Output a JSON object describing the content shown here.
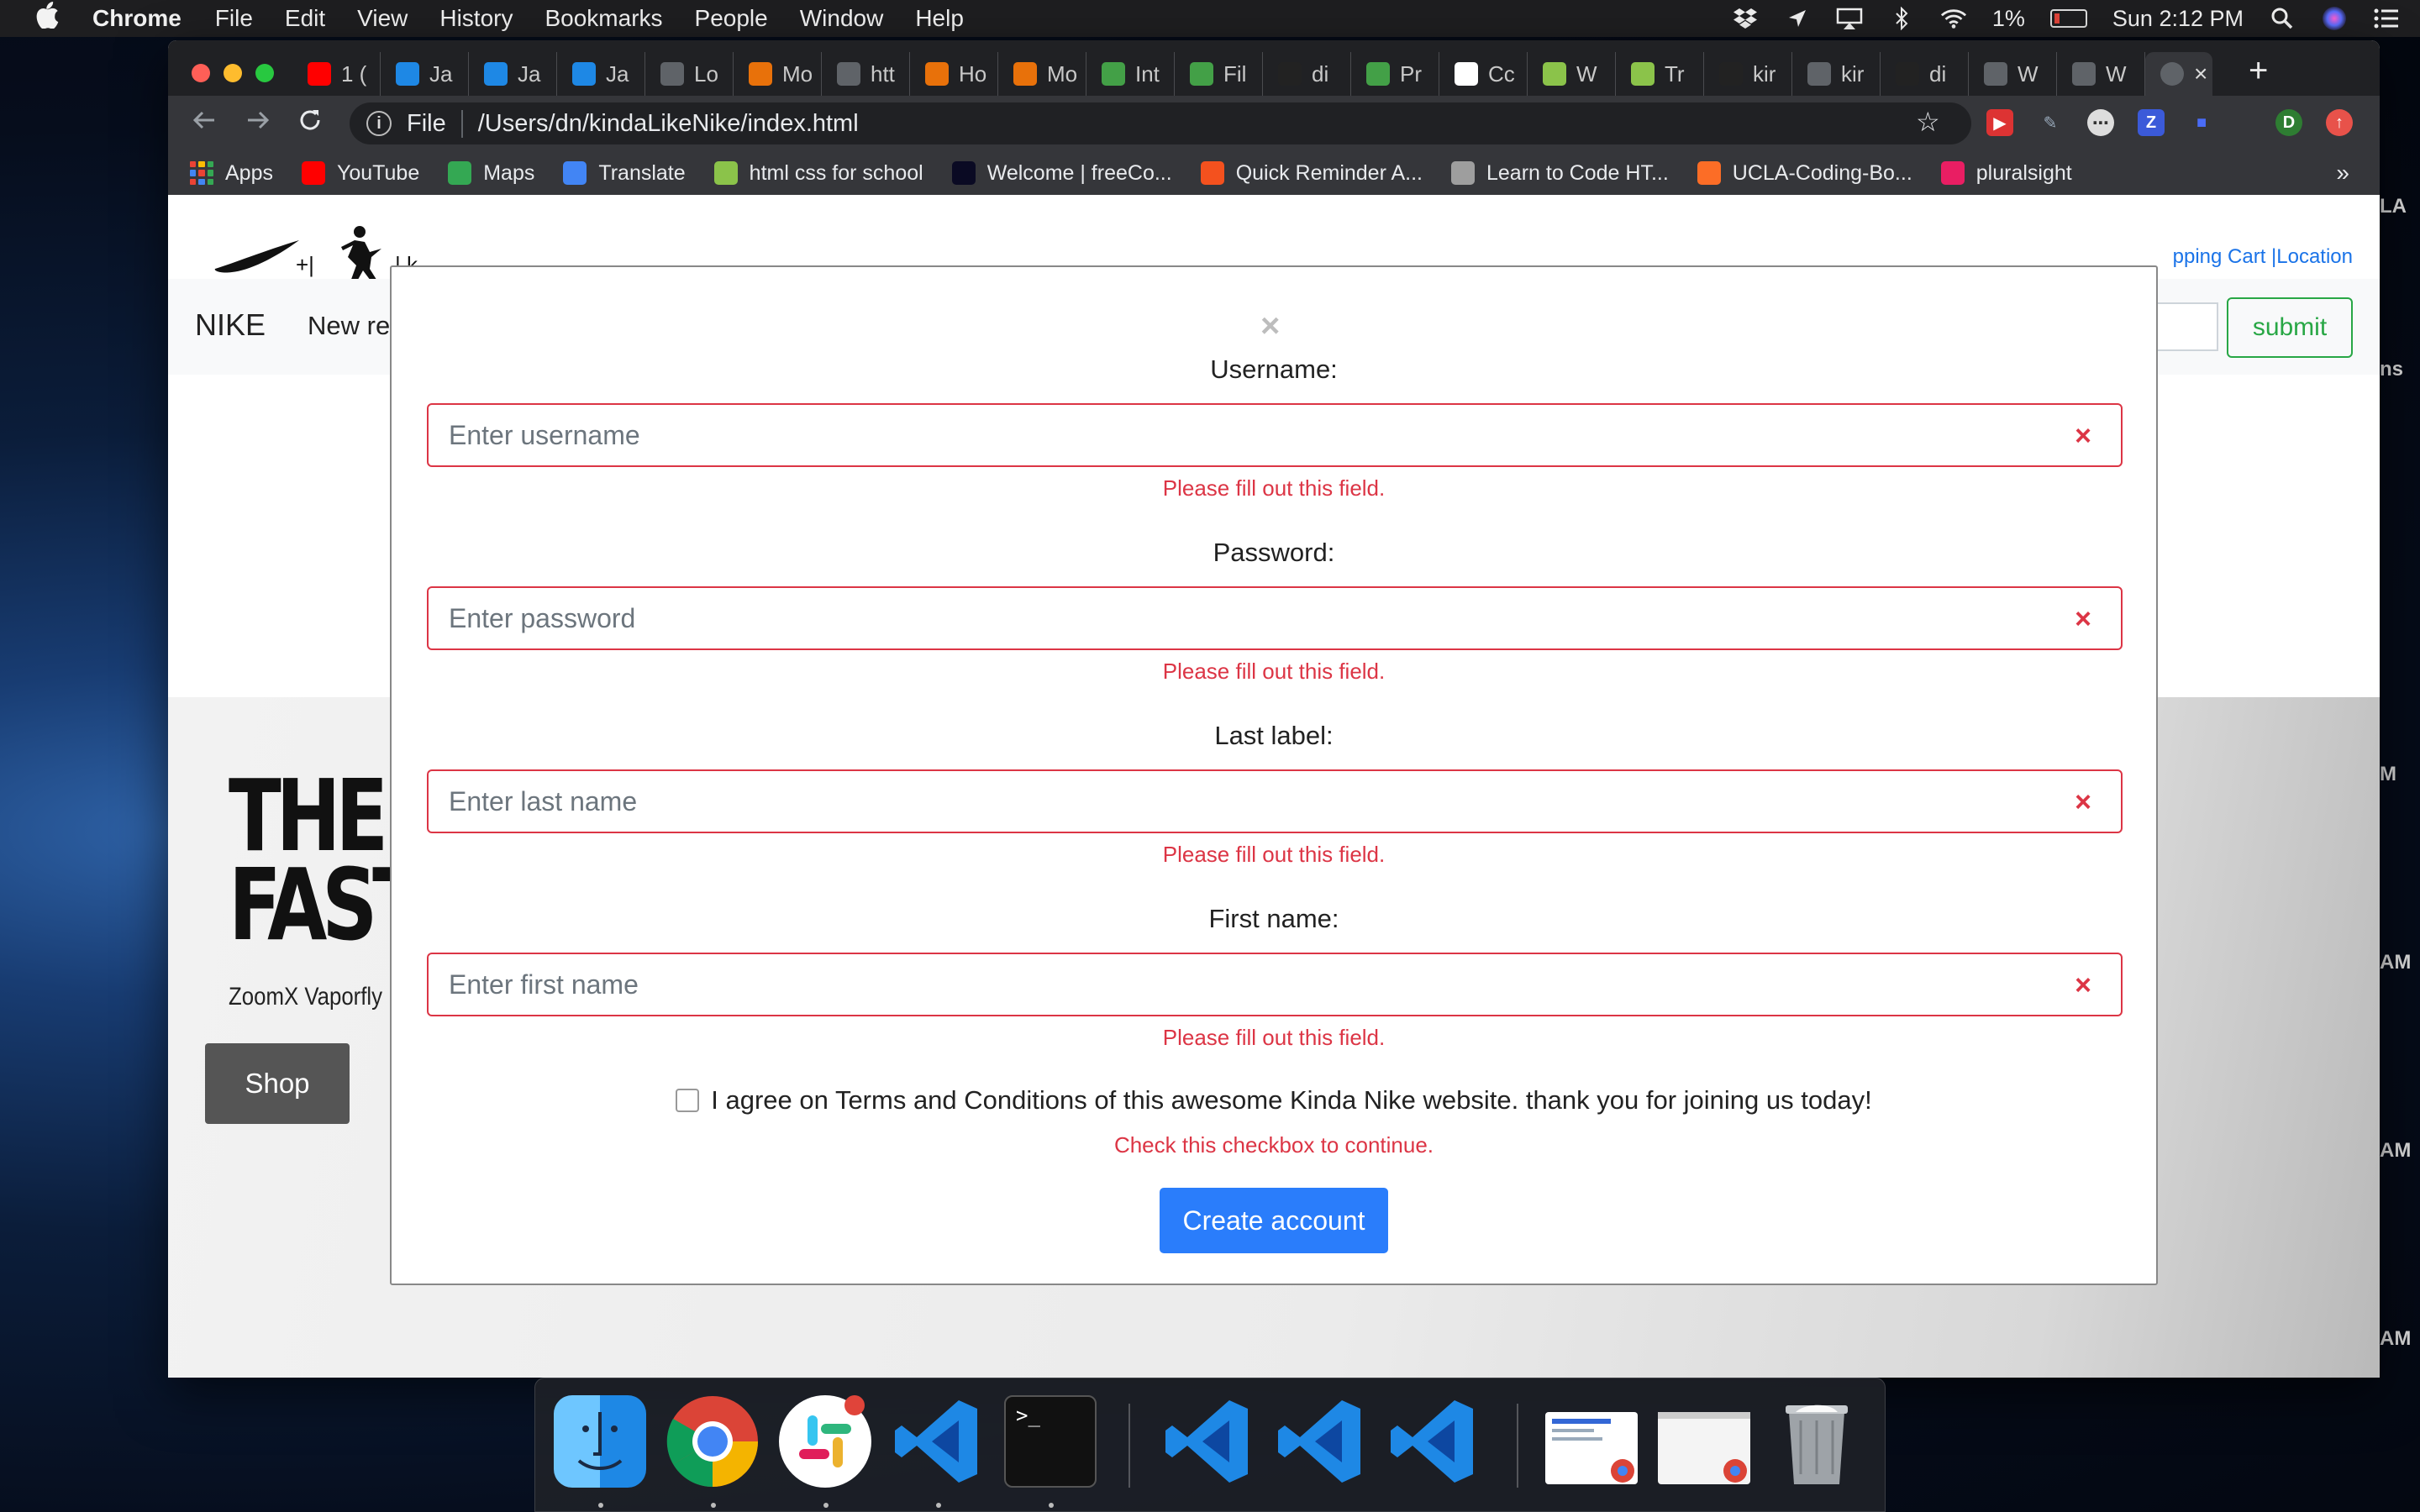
{
  "menubar": {
    "app_name": "Chrome",
    "items": [
      "File",
      "Edit",
      "View",
      "History",
      "Bookmarks",
      "People",
      "Window",
      "Help"
    ],
    "battery": "1%",
    "clock": "Sun 2:12 PM"
  },
  "browser": {
    "tabs": [
      {
        "label": "1 (",
        "favicon_color": "#ff0000"
      },
      {
        "label": "Ja",
        "favicon_color": "#1e88e5"
      },
      {
        "label": "Ja",
        "favicon_color": "#1e88e5"
      },
      {
        "label": "Ja",
        "favicon_color": "#1e88e5"
      },
      {
        "label": "Lo",
        "favicon_color": "#5f6368"
      },
      {
        "label": "Mo",
        "favicon_color": "#e8710a"
      },
      {
        "label": "htt",
        "favicon_color": "#5f6368"
      },
      {
        "label": "Ho",
        "favicon_color": "#e8710a"
      },
      {
        "label": "Mo",
        "favicon_color": "#e8710a"
      },
      {
        "label": "Int",
        "favicon_color": "#43a047"
      },
      {
        "label": "Fil",
        "favicon_color": "#43a047"
      },
      {
        "label": "di",
        "favicon_color": "#222222"
      },
      {
        "label": "Pr",
        "favicon_color": "#43a047"
      },
      {
        "label": "Cc",
        "favicon_color": "#ffffff"
      },
      {
        "label": "W",
        "favicon_color": "#8bc34a"
      },
      {
        "label": "Tr",
        "favicon_color": "#8bc34a"
      },
      {
        "label": "kir",
        "favicon_color": "#222222"
      },
      {
        "label": "kir",
        "favicon_color": "#5f6368"
      },
      {
        "label": "di",
        "favicon_color": "#222222"
      },
      {
        "label": "W",
        "favicon_color": "#5f6368"
      },
      {
        "label": "W",
        "favicon_color": "#5f6368"
      }
    ],
    "active_tab_close": "×",
    "new_tab": "+",
    "url_scheme": "File",
    "url": "/Users/dn/kindaLikeNike/index.html",
    "bookmarks": [
      {
        "label": "Apps",
        "icon": "apps-grid-icon"
      },
      {
        "label": "YouTube",
        "favicon_color": "#ff0000"
      },
      {
        "label": "Maps",
        "favicon_color": "#34a853"
      },
      {
        "label": "Translate",
        "favicon_color": "#4285f4"
      },
      {
        "label": "html css for school",
        "favicon_color": "#8bc34a"
      },
      {
        "label": "Welcome | freeCo...",
        "favicon_color": "#0a0a23"
      },
      {
        "label": "Quick Reminder A...",
        "favicon_color": "#f4511e"
      },
      {
        "label": "Learn to Code HT...",
        "favicon_color": "#9e9e9e"
      },
      {
        "label": "UCLA-Coding-Bo...",
        "favicon_color": "#fc6d26"
      },
      {
        "label": "pluralsight",
        "favicon_color": "#e91e63"
      }
    ],
    "bookmarks_more": "»",
    "profile_initial": "D",
    "ext_z": "Z"
  },
  "site": {
    "top_links": "pping Cart |Location",
    "brand": "NIKE",
    "nav_partial": "New re",
    "submit_label": "submit",
    "hero_title_line1": "THE I",
    "hero_title_line2": "FASTI",
    "hero_sub": "ZoomX Vaporfly N",
    "shop_label": "Shop"
  },
  "peek_labels": [
    "LA",
    "ns",
    "M",
    "AM",
    "AM",
    "AM"
  ],
  "modal": {
    "close_glyph": "×",
    "fields": [
      {
        "label": "Username:",
        "placeholder": "Enter username",
        "feedback": "Please fill out this field."
      },
      {
        "label": "Password:",
        "placeholder": "Enter password",
        "feedback": "Please fill out this field."
      },
      {
        "label": "Last label:",
        "placeholder": "Enter last name",
        "feedback": "Please fill out this field."
      },
      {
        "label": "First name:",
        "placeholder": "Enter first name",
        "feedback": "Please fill out this field."
      }
    ],
    "invalid_glyph": "×",
    "terms_text": "I agree on Terms and Conditions of this awesome Kinda Nike website. thank you for joining us today!",
    "terms_feedback": "Check this checkbox to continue.",
    "submit_label": "Create account"
  },
  "dock": {
    "apps": [
      "finder-icon",
      "chrome-icon",
      "slack-icon",
      "vscode-icon",
      "terminal-icon",
      "vscode-icon",
      "vscode-icon",
      "vscode-icon",
      "chrome-window-icon",
      "chrome-window-icon",
      "trash-icon"
    ],
    "terminal_prompt": ">_"
  }
}
